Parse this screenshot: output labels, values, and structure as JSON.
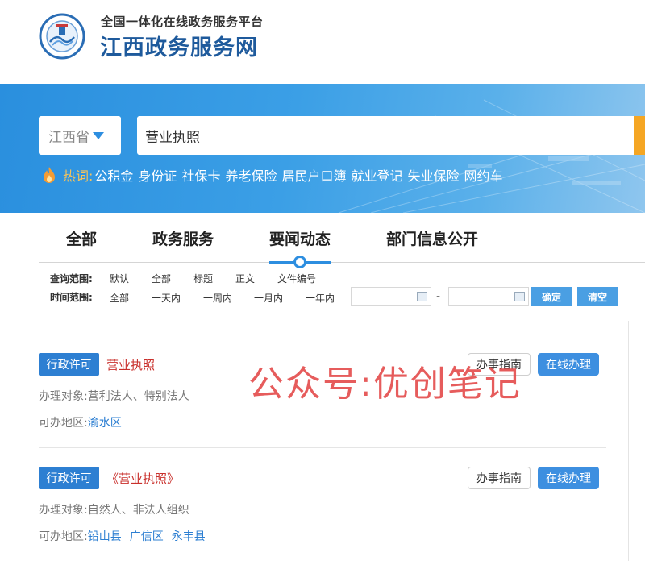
{
  "header": {
    "subtitle": "全国一体化在线政务服务平台",
    "title": "江西政务服务网",
    "logo_icon": "province-emblem-icon",
    "brand_color": "#1e5a9c"
  },
  "search": {
    "region": "江西省",
    "query": "营业执照",
    "button_color": "#f5a623"
  },
  "hot": {
    "label": "热词:",
    "keywords": [
      "公积金",
      "身份证",
      "社保卡",
      "养老保险",
      "居民户口簿",
      "就业登记",
      "失业保险",
      "网约车"
    ]
  },
  "tabs": [
    {
      "label": "全部"
    },
    {
      "label": "政务服务"
    },
    {
      "label": "要闻动态",
      "active": true
    },
    {
      "label": "部门信息公开"
    }
  ],
  "filters": {
    "scope_label": "查询范围:",
    "scope_options": [
      "默认",
      "全部",
      "标题",
      "正文",
      "文件编号"
    ],
    "time_label": "时间范围:",
    "time_options": [
      "全部",
      "一天内",
      "一周内",
      "一月内",
      "一年内"
    ],
    "date_separator": "-",
    "confirm_label": "确定",
    "clear_label": "清空"
  },
  "results": [
    {
      "badge": "行政许可",
      "title": "营业执照",
      "target_label": "办理对象:",
      "target_value": "营利法人、特别法人",
      "area_label": "可办地区:",
      "areas": [
        "渝水区"
      ],
      "guide_label": "办事指南",
      "online_label": "在线办理"
    },
    {
      "badge": "行政许可",
      "title": "《营业执照》",
      "target_label": "办理对象:",
      "target_value": "自然人、非法人组织",
      "area_label": "可办地区:",
      "areas": [
        "铅山县",
        "广信区",
        "永丰县"
      ],
      "guide_label": "办事指南",
      "online_label": "在线办理"
    }
  ],
  "watermark": "公众号:优创笔记",
  "colors": {
    "accent": "#2d8ee0",
    "badge": "#2d7fd2",
    "title_red": "#c9302c",
    "banner": "#3b9fe6"
  }
}
